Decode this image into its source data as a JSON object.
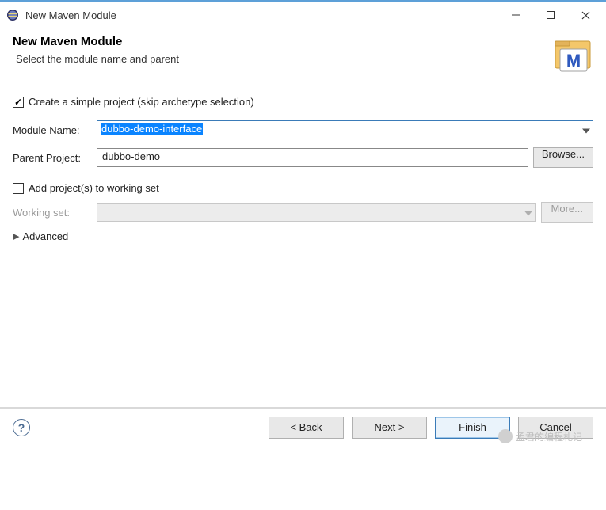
{
  "titlebar": {
    "title": "New Maven Module"
  },
  "header": {
    "title": "New Maven Module",
    "subtitle": "Select the module name and parent"
  },
  "form": {
    "simple_project_label": "Create a simple project (skip archetype selection)",
    "module_name_label": "Module Name:",
    "module_name_value": "dubbo-demo-interface",
    "parent_label": "Parent Project:",
    "parent_value": "dubbo-demo",
    "browse_label": "Browse...",
    "add_to_ws_label": "Add project(s) to working set",
    "working_set_label": "Working set:",
    "more_label": "More...",
    "advanced_label": "Advanced"
  },
  "buttons": {
    "back": "< Back",
    "next": "Next >",
    "finish": "Finish",
    "cancel": "Cancel"
  },
  "watermark": "孟君的编程札记"
}
